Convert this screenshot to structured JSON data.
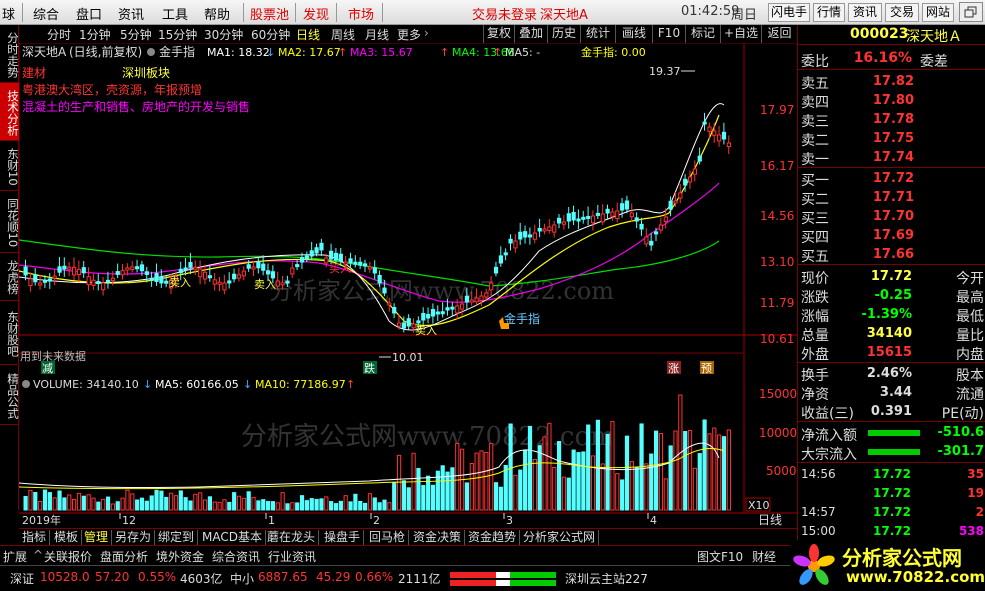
{
  "menu": {
    "items": [
      "球",
      "综合",
      "盘口",
      "资讯",
      "工具",
      "帮助"
    ],
    "red_items": [
      "股票池",
      "发现",
      "市场"
    ],
    "login_status": "交易未登录",
    "stock_title": "深天地A",
    "time": "01:42:59",
    "weekday": "周日",
    "right_buttons": [
      "闪电手",
      "行情",
      "资讯",
      "交易",
      "网站"
    ]
  },
  "left_nav": [
    {
      "label": "分时走势",
      "active": false
    },
    {
      "label": "技术分析",
      "active": true
    },
    {
      "label": "东财10",
      "active": false
    },
    {
      "label": "同花顺10",
      "active": false
    },
    {
      "label": "龙虎榜",
      "active": false
    },
    {
      "label": "东财股吧",
      "active": false
    },
    {
      "label": "精品公式",
      "active": false
    }
  ],
  "toolbar": {
    "periods": [
      "分时",
      "1分钟",
      "5分钟",
      "15分钟",
      "30分钟",
      "60分钟",
      "日线",
      "周线",
      "月线",
      "更多"
    ],
    "current_period": "日线",
    "more_arrow": "›",
    "right": [
      "复权",
      "叠加",
      "历史",
      "统计",
      "画线",
      "F10",
      "标记",
      "+自选",
      "返回"
    ]
  },
  "chart_header": {
    "name": "深天地A",
    "mode": "(日线,前复权)",
    "indicator": "金手指",
    "ma1": "MA1: 18.32",
    "ma2": "MA2: 17.67",
    "ma3": "MA3: 15.67",
    "ma4": "MA4: 13.68",
    "ma5": "MA5: -",
    "indicator_value": "金手指: 0.00",
    "arrow_down": "↓",
    "arrow_up": "↑"
  },
  "annotations": {
    "line1_a": "建材",
    "line1_b": "深圳板块",
    "line2": "粤港澳大湾区，壳资源，年报预增",
    "line3": "混凝土的生产和销售、房地产的开发与销售",
    "high_label": "19.37",
    "low_label": "10.01",
    "buy_label": "买入",
    "sell_label": "卖入",
    "finger_label": "金手指",
    "future_label": "用到未来数据",
    "watermark": "分析家公式网www.70822.com",
    "marker_jian": "减",
    "marker_die": "跌",
    "marker_zhang": "涨",
    "marker_yu": "预"
  },
  "price_axis": [
    "17.97",
    "16.17",
    "14.56",
    "13.10",
    "11.79",
    "10.61"
  ],
  "volume_header": {
    "volume": "VOLUME: 34140.10",
    "ma5": "MA5: 60166.05",
    "ma10": "MA10: 77186.97",
    "arrow_down": "↓",
    "arrow_up": "↑"
  },
  "volume_axis": [
    "15000",
    "10000",
    "5000"
  ],
  "volume_unit": "X10",
  "date_axis": {
    "labels": [
      "2019年",
      "12",
      "1",
      "2",
      "3",
      "4"
    ],
    "period": "日线"
  },
  "bottom_tabs": [
    "指标",
    "模板",
    "管理",
    "另存为",
    "绑定到",
    "MACD基本",
    "蘑在龙头",
    "操盘手",
    "回马枪",
    "资金决策",
    "资金趋势",
    "分析家公式网"
  ],
  "bottom_tabs_current": "管理",
  "index_bar": {
    "expand": "扩展",
    "items": [
      "关联报价",
      "盘面分析",
      "境外资金",
      "综合资讯",
      "行业资讯"
    ],
    "right": [
      "图文F10",
      "财经"
    ]
  },
  "status_bar": {
    "sz_label": "深证",
    "sz_value": "10528.0",
    "sz_change": "57.20",
    "sz_pct": "0.55%",
    "sz_amount": "4603亿",
    "zx_label": "中小",
    "zx_value": "6887.65",
    "zx_change": "45.29",
    "zx_pct": "0.66%",
    "zx_amount": "2111亿",
    "server": "深圳云主站227"
  },
  "quote": {
    "code": "000023",
    "name": "深天地Ａ",
    "weibi_label": "委比",
    "weibi_value": "16.16%",
    "weicha_label": "委差",
    "sell": [
      {
        "label": "卖五",
        "price": "17.82"
      },
      {
        "label": "卖四",
        "price": "17.80"
      },
      {
        "label": "卖三",
        "price": "17.78"
      },
      {
        "label": "卖二",
        "price": "17.75"
      },
      {
        "label": "卖一",
        "price": "17.74"
      }
    ],
    "buy": [
      {
        "label": "买一",
        "price": "17.72"
      },
      {
        "label": "买二",
        "price": "17.71"
      },
      {
        "label": "买三",
        "price": "17.70"
      },
      {
        "label": "买四",
        "price": "17.69"
      },
      {
        "label": "买五",
        "price": "17.66"
      }
    ],
    "stats": [
      {
        "label": "现价",
        "value": "17.72",
        "right": "今开",
        "color": "#ff4"
      },
      {
        "label": "涨跌",
        "value": "-0.25",
        "right": "最高",
        "color": "#0f0"
      },
      {
        "label": "涨幅",
        "value": "-1.39%",
        "right": "最低",
        "color": "#0f0"
      },
      {
        "label": "总量",
        "value": "34140",
        "right": "量比",
        "color": "#ff4"
      },
      {
        "label": "外盘",
        "value": "15615",
        "right": "内盘",
        "color": "#f33"
      }
    ],
    "stats2": [
      {
        "label": "换手",
        "value": "2.46%",
        "right": "股本"
      },
      {
        "label": "净资",
        "value": "3.44",
        "right": "流通"
      },
      {
        "label": "收益(三)",
        "value": "0.391",
        "right": "PE(动)"
      }
    ],
    "flows": [
      {
        "label": "净流入额",
        "value": "-510.6"
      },
      {
        "label": "大宗流入",
        "value": "-301.7"
      }
    ],
    "ticks": [
      {
        "time": "14:56",
        "price": "17.72",
        "vol": "35"
      },
      {
        "time": "",
        "price": "17.72",
        "vol": "19"
      },
      {
        "time": "14:57",
        "price": "17.72",
        "vol": "2"
      },
      {
        "time": "15:00",
        "price": "17.72",
        "vol": "538"
      }
    ]
  },
  "logo": {
    "text": "分析家公式网",
    "url": "www.70822.com"
  },
  "colors": {
    "up": "#ff3232",
    "down": "#54ffff",
    "ma1": "#ffffff",
    "ma2": "#ffff00",
    "ma3": "#ff00ff",
    "ma4": "#00ff00",
    "frame": "#700000"
  },
  "chart_data": {
    "type": "candlestick",
    "ylim": [
      10.01,
      19.37
    ],
    "volume_ylim": [
      0,
      16000
    ]
  }
}
